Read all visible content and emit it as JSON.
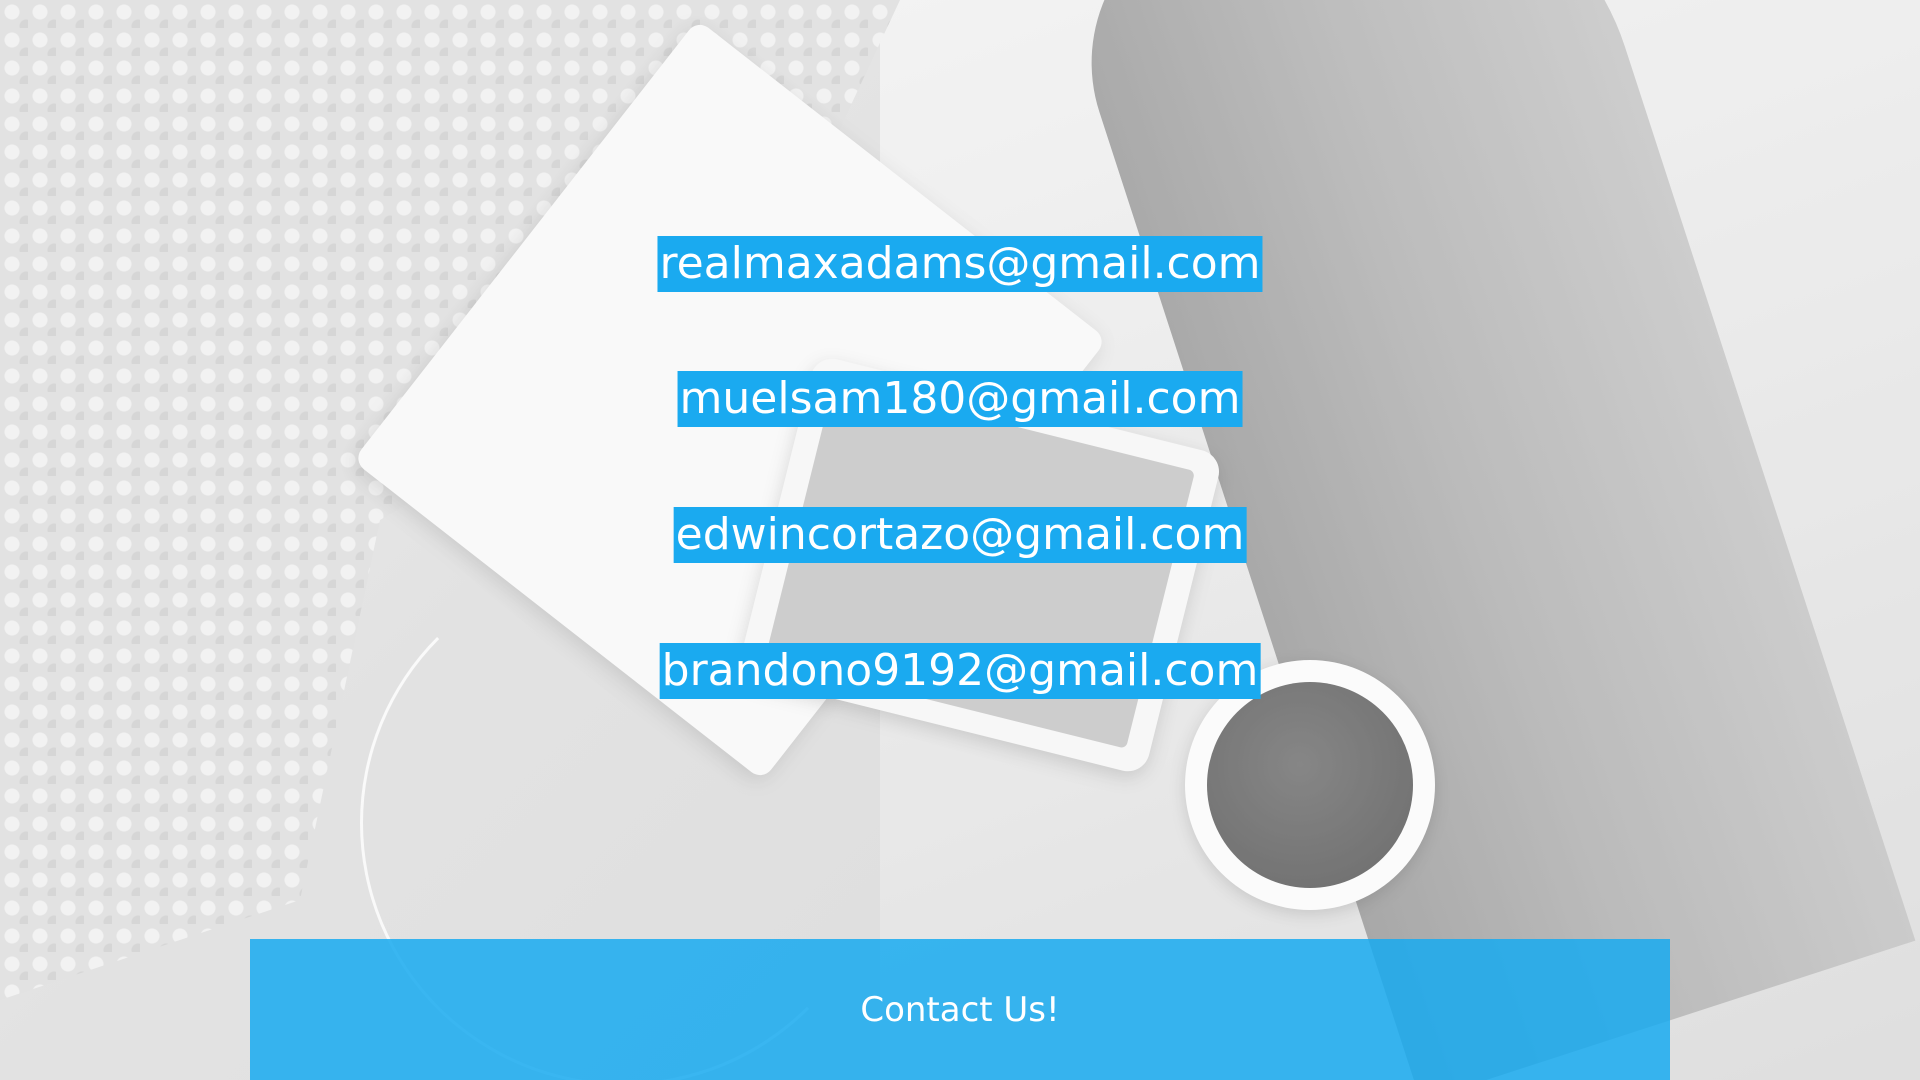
{
  "contacts": {
    "emails": [
      "realmaxadams@gmail.com",
      "muelsam180@gmail.com",
      "edwincortazo@gmail.com",
      "brandono9192@gmail.com"
    ]
  },
  "cta": {
    "label": "Contact Us!"
  },
  "colors": {
    "accent": "#1aaaf0",
    "text_on_accent": "#ffffff"
  }
}
